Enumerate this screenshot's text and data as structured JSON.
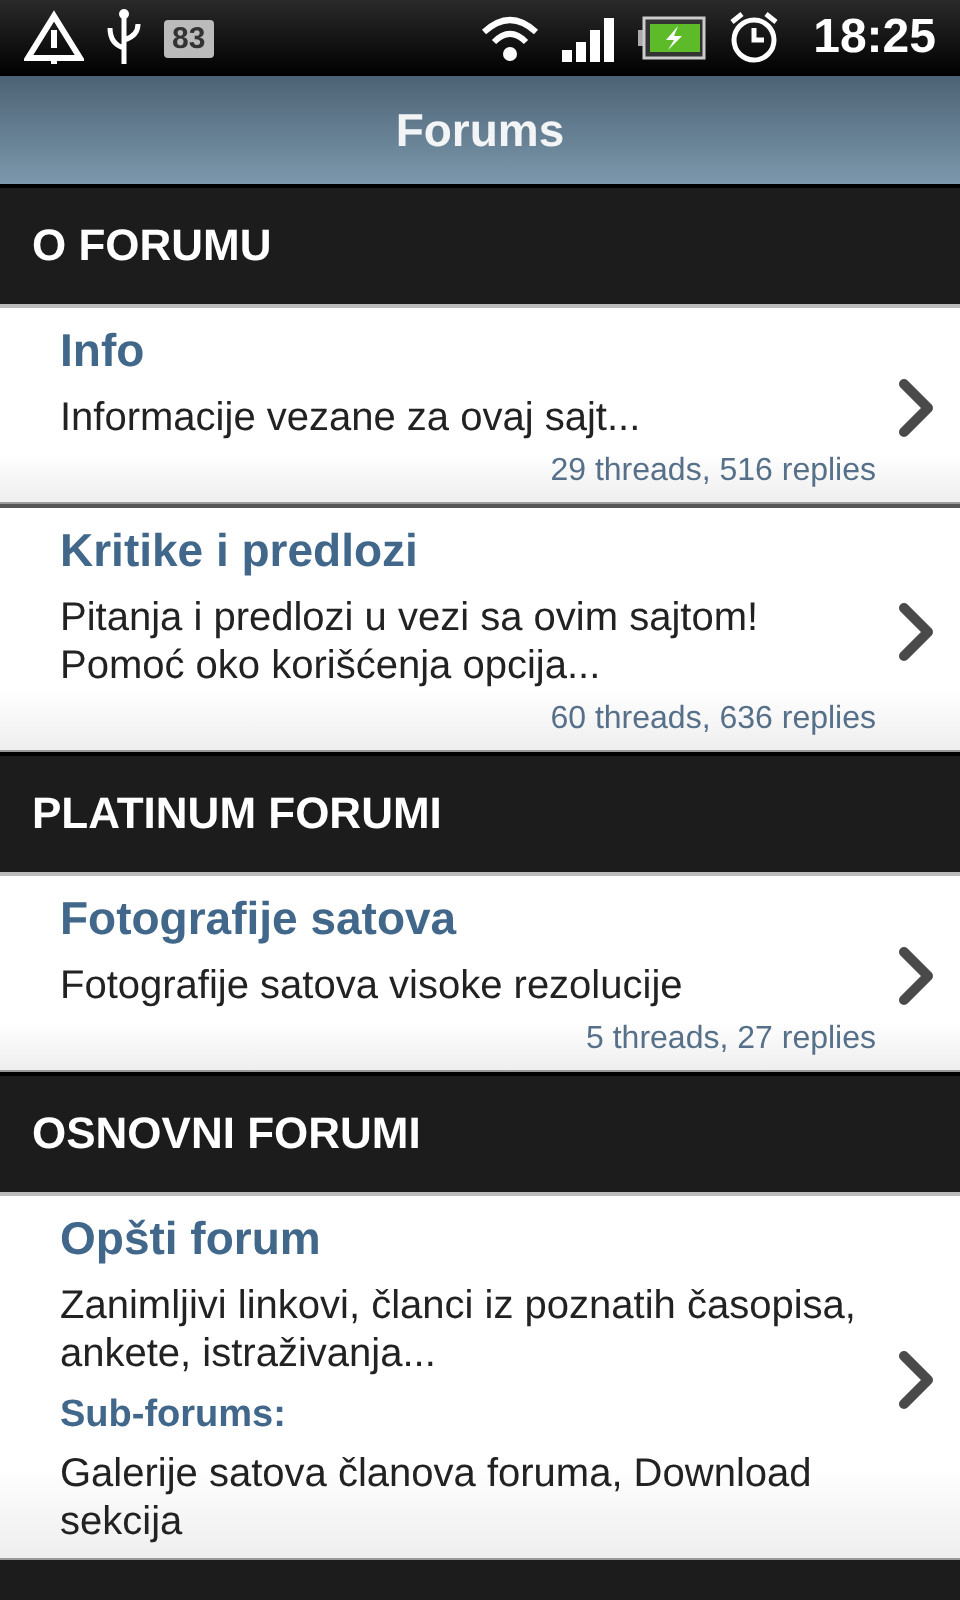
{
  "status_bar": {
    "badge": "83",
    "time": "18:25"
  },
  "title": "Forums",
  "sections": [
    {
      "title": "O FORUMU",
      "forums": [
        {
          "name": "Info",
          "description": "Informacije vezane za ovaj sajt...",
          "stats": "29 threads, 516 replies"
        },
        {
          "name": "Kritike i predlozi",
          "description": "Pitanja i predlozi u vezi sa ovim sajtom! Pomoć oko korišćenja opcija...",
          "stats": "60 threads, 636 replies"
        }
      ]
    },
    {
      "title": "PLATINUM FORUMI",
      "forums": [
        {
          "name": "Fotografije satova",
          "description": "Fotografije satova visoke rezolucije",
          "stats": "5 threads, 27 replies"
        }
      ]
    },
    {
      "title": "OSNOVNI FORUMI",
      "forums": [
        {
          "name": "Opšti forum",
          "description": "Zanimljivi linkovi, članci iz poznatih časopisa, ankete, istraživanja...",
          "subforums_label": "Sub-forums:",
          "subforums": "Galerije satova članova foruma, Download sekcija"
        }
      ]
    }
  ]
}
